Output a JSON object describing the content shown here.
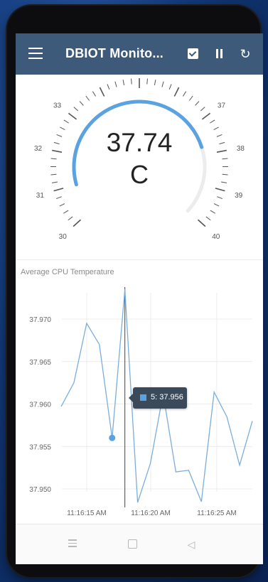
{
  "app": {
    "title": "DBIOT Monito...",
    "actions": [
      "check-icon",
      "pause-icon",
      "refresh-icon"
    ]
  },
  "gauge": {
    "value": "37.74",
    "unit": "C",
    "reading": 37.74,
    "min": 30,
    "max": 40,
    "range_start": 31,
    "tick_labels": [
      "30",
      "31",
      "32",
      "33",
      "37",
      "38",
      "39",
      "40"
    ],
    "accent_color": "#5aa3e0"
  },
  "chart_data": {
    "type": "line",
    "title": "Average CPU Temperature",
    "x": [
      "0",
      "1",
      "2",
      "3",
      "4",
      "5",
      "6",
      "7",
      "8",
      "9",
      "10",
      "11",
      "12",
      "13",
      "14",
      "15",
      "16"
    ],
    "xticks": [
      "11:16:15 AM",
      "11:16:20 AM",
      "11:16:25 AM"
    ],
    "yticks": [
      "37.950",
      "37.955",
      "37.960",
      "37.965",
      "37.970"
    ],
    "ylim": [
      37.948,
      37.972
    ],
    "series": [
      {
        "values": [
          37.9597,
          37.9625,
          37.9695,
          37.967,
          37.956,
          37.9735,
          37.9484,
          37.953,
          37.9612,
          37.952,
          37.9522,
          37.9485,
          37.9614,
          37.9585,
          37.9528,
          37.958
        ]
      }
    ],
    "highlight_index": 4,
    "cursor_index": 5,
    "grid": true,
    "color": "#7aaedc"
  },
  "tooltip": {
    "text": "5: 37.956"
  },
  "navbar": {
    "items": [
      "recent-apps-icon",
      "home-icon",
      "back-icon"
    ]
  }
}
